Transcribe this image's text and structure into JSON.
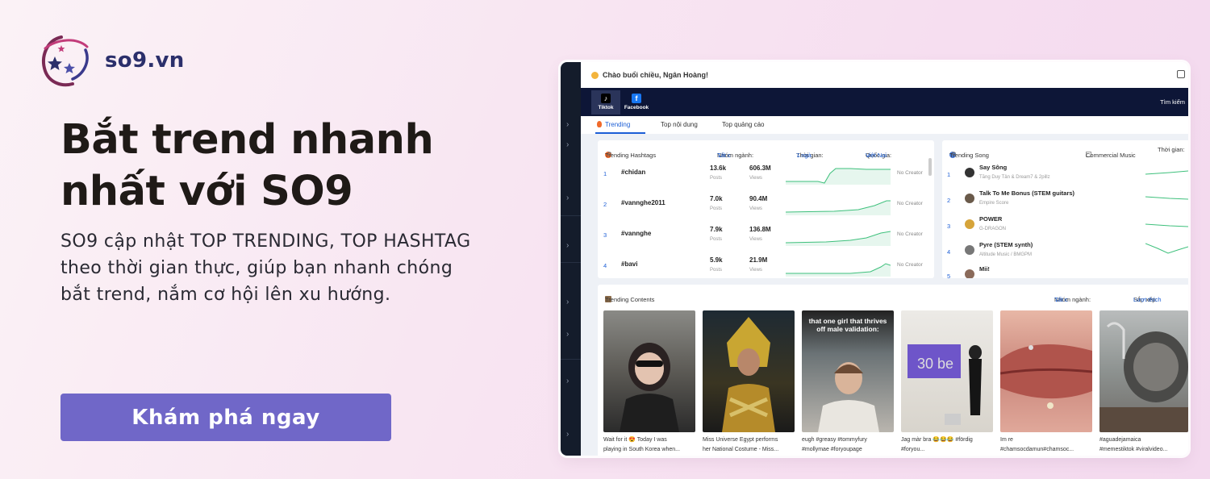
{
  "brand": {
    "name": "so9.vn"
  },
  "hero": {
    "headline_1": "Bắt trend nhanh",
    "headline_2": "nhất với SO9",
    "sub_1": "SO9 cập nhật TOP TRENDING, TOP HASHTAG",
    "sub_2": "theo thời gian thực, giúp bạn nhanh chóng",
    "sub_3": "bắt trend, nắm cơ hội lên xu hướng.",
    "cta": "Khám phá ngay"
  },
  "app": {
    "greeting": "Chào buổi chiều, Ngân Hoàng!",
    "platforms": [
      "Tiktok",
      "Facebook"
    ],
    "search": "Tìm kiếm",
    "tabs": [
      "Trending",
      "Top nội dung",
      "Top quảng cáo"
    ],
    "hashtags": {
      "title": "Trending Hashtags",
      "filter_industry_label": "Nhóm ngành:",
      "filter_industry_value": "Tất c",
      "filter_time_label": "Thời gian:",
      "filter_time_value": "7 ngà",
      "filter_country_label": "Quốc gia:",
      "filter_country_value": "Việt Nai",
      "posts_unit": "Posts",
      "views_unit": "Views",
      "rows": [
        {
          "rank": "1",
          "tag": "#chidan",
          "posts": "13.6k",
          "views": "606.3M",
          "creator": "No Creator"
        },
        {
          "rank": "2",
          "tag": "#vannghe2011",
          "posts": "7.0k",
          "views": "90.4M",
          "creator": "No Creator"
        },
        {
          "rank": "3",
          "tag": "#vannghe",
          "posts": "7.9k",
          "views": "136.8M",
          "creator": "No Creator"
        },
        {
          "rank": "4",
          "tag": "#bavi",
          "posts": "5.9k",
          "views": "21.9M",
          "creator": "No Creator"
        }
      ]
    },
    "songs": {
      "title": "Trending Song",
      "commercial": "Commercial Music",
      "time_label": "Thời gian:",
      "rows": [
        {
          "rank": "1",
          "title": "Say Sông",
          "artist": "Tăng Duy Tân & Dream7 & 2pillz"
        },
        {
          "rank": "2",
          "title": "Talk To Me Bonus (STEM guitars)",
          "artist": "Empire Score"
        },
        {
          "rank": "3",
          "title": "POWER",
          "artist": "G-DRAGON"
        },
        {
          "rank": "4",
          "title": "Pyre (STEM synth)",
          "artist": "Altitude Music / BMGPM"
        },
        {
          "rank": "5",
          "title": "Mii!",
          "artist": ""
        }
      ]
    },
    "contents": {
      "title": "Trending Contents",
      "industry_label": "Nhóm ngành:",
      "industry_value": "Tất c",
      "sort_label": "Sắp xếp:",
      "sort_value": "Lượt thích",
      "overlay_text": "that one girl that thrives off male validation:",
      "tv_text": "30 be",
      "items": [
        {
          "cap1": "Wait for it 😍 Today I was",
          "cap2": "playing in South Korea when..."
        },
        {
          "cap1": "Miss Universe Egypt performs",
          "cap2": "her National Costume - Miss..."
        },
        {
          "cap1": "eugh #greasy #tommyfury",
          "cap2": "#mollymae #foryoupage"
        },
        {
          "cap1": "Jag màr bra 😂😂😂 #fördig",
          "cap2": "#foryou..."
        },
        {
          "cap1": "Im re",
          "cap2": "#chamsocdamun#chamsoc..."
        },
        {
          "cap1": "#aguadejamaica",
          "cap2": "#memestiktok #viralvideo..."
        }
      ]
    }
  }
}
